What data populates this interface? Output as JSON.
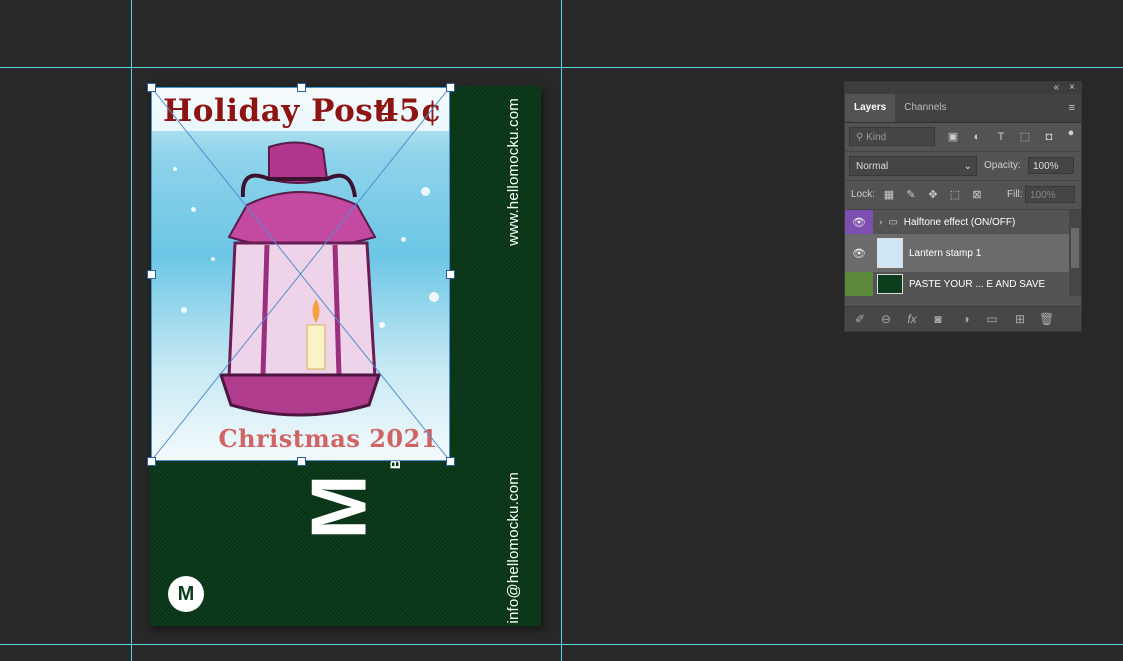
{
  "card": {
    "website": "www.hellomocku.com",
    "email": "info@hellomocku.com",
    "big_letter": "M",
    "small_letter": "B",
    "logo_letter": "M"
  },
  "stamp": {
    "title": "Holiday Post",
    "price": "45¢",
    "footer": "Christmas 2021"
  },
  "layers_panel": {
    "collapse_icon": "«",
    "close_icon": "×",
    "tabs": [
      "Layers",
      "Channels"
    ],
    "filter_placeholder": "Kind",
    "blend_mode": "Normal",
    "opacity_label": "Opacity:",
    "opacity_value": "100%",
    "lock_label": "Lock:",
    "fill_label": "Fill:",
    "fill_value": "100%",
    "layers": [
      {
        "name": "Halftone effect (ON/OFF)",
        "type": "group",
        "color": "#7d4fb0"
      },
      {
        "name": "Lantern stamp 1",
        "type": "smart-object",
        "color": "#535353"
      },
      {
        "name": "PASTE YOUR ... E AND SAVE",
        "type": "smart-object",
        "color": "#5d8a3a"
      }
    ]
  },
  "colors": {
    "canvas_bg": "#282828",
    "guide": "#5fd4e6",
    "card_green": "#0c3d1c",
    "stamp_red": "#8e1414"
  }
}
